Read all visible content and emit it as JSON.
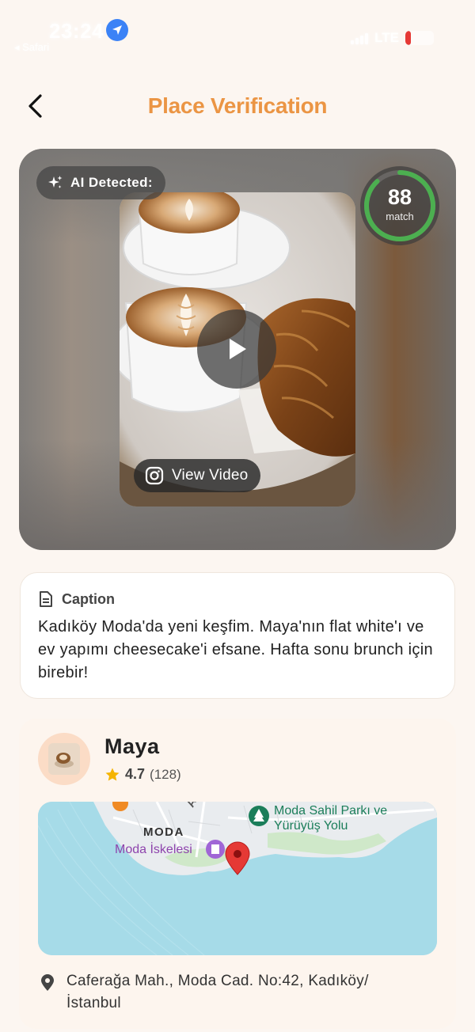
{
  "status_bar": {
    "time": "23:24",
    "back_app": "◂ Safari",
    "network": "LTE"
  },
  "header": {
    "title": "Place Verification"
  },
  "media": {
    "ai_badge_label": "AI Detected:",
    "match_score": "88",
    "match_label": "match",
    "match_value_percent": 88,
    "view_video_label": "View Video"
  },
  "caption": {
    "heading": "Caption",
    "text": "Kadıköy Moda'da yeni keşfim. Maya'nın flat white'ı ve ev yapımı cheesecake'i efsane. Hafta sonu brunch için birebir!"
  },
  "place": {
    "name": "Maya",
    "rating": "4.7",
    "review_count": "(128)",
    "address": "Caferağa Mah., Moda Cad. No:42, Kadıköy/İstanbul",
    "map": {
      "label_district": "MODA",
      "label_pier": "Moda İskelesi",
      "label_park": "Moda Sahil Parkı ve Yürüyüş Yolu",
      "label_street": "Alt"
    }
  },
  "colors": {
    "accent": "#eb9544",
    "match_ring": "#4caf50",
    "pin": "#e53935",
    "water": "#a6dbe8",
    "pier_label": "#8e44ad",
    "park_label": "#1b7e5a"
  }
}
